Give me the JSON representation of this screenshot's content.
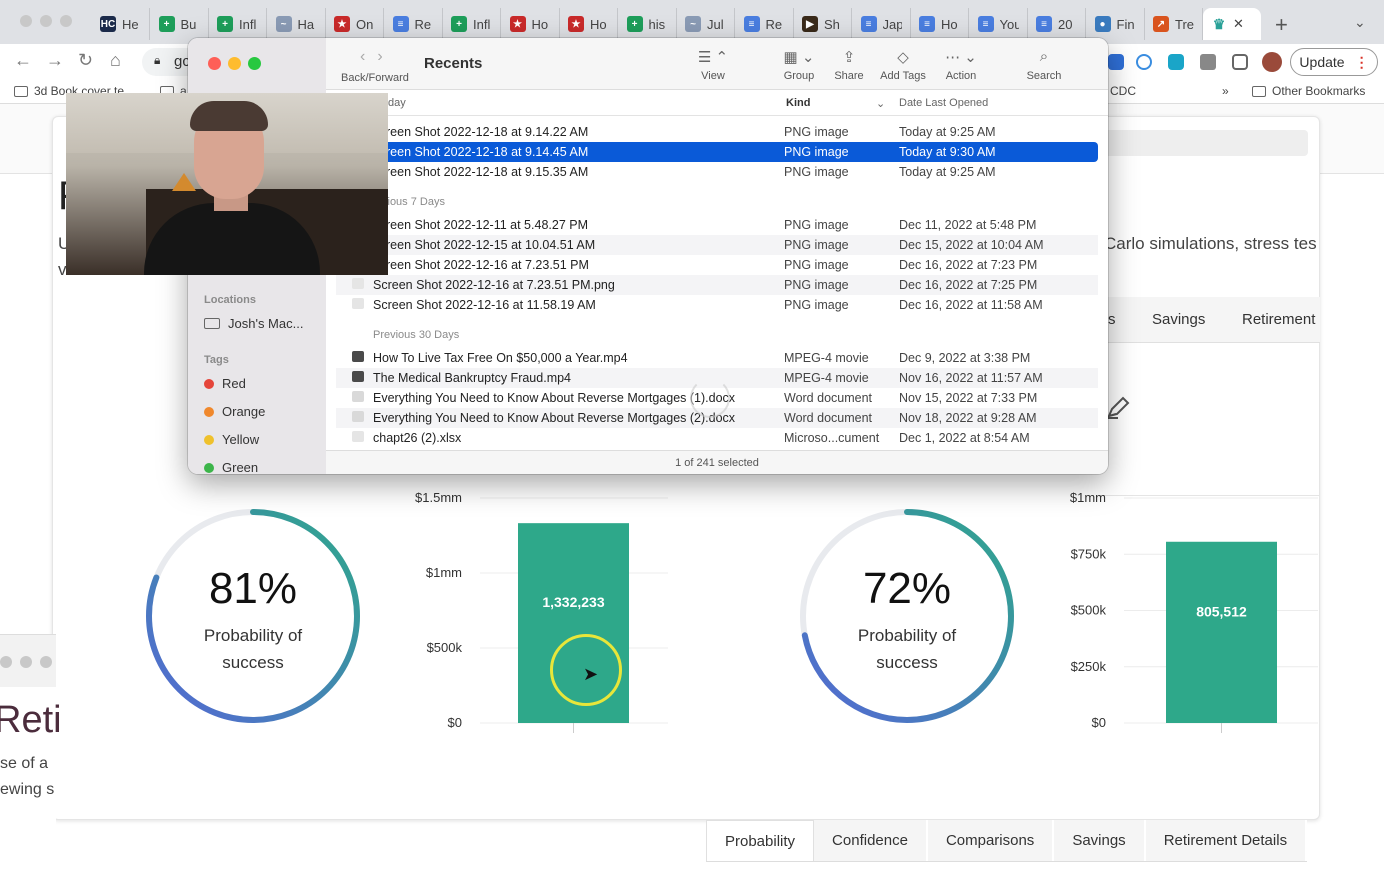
{
  "browser": {
    "tabs": [
      {
        "label": "He",
        "favicon": "hc-icon",
        "color": "#1b2a4a",
        "glyph": "HC"
      },
      {
        "label": "Bu",
        "favicon": "sheets-icon",
        "color": "#1e9e5a",
        "glyph": "+"
      },
      {
        "label": "Infl",
        "favicon": "sheets-icon",
        "color": "#1e9e5a",
        "glyph": "+"
      },
      {
        "label": "Ha",
        "favicon": "image-icon",
        "color": "#8a9bb5",
        "glyph": "~"
      },
      {
        "label": "On",
        "favicon": "star-icon",
        "color": "#c92a2a",
        "glyph": "★"
      },
      {
        "label": "Re",
        "favicon": "docs-icon",
        "color": "#4a7ee0",
        "glyph": "≡"
      },
      {
        "label": "Infl",
        "favicon": "sheets-icon",
        "color": "#1e9e5a",
        "glyph": "+"
      },
      {
        "label": "Ho",
        "favicon": "star-icon",
        "color": "#c92a2a",
        "glyph": "★"
      },
      {
        "label": "Ho",
        "favicon": "star-icon",
        "color": "#c92a2a",
        "glyph": "★"
      },
      {
        "label": "his",
        "favicon": "sheets-icon",
        "color": "#1e9e5a",
        "glyph": "+"
      },
      {
        "label": "Jul",
        "favicon": "image-icon",
        "color": "#8a9bb5",
        "glyph": "~"
      },
      {
        "label": "Re",
        "favicon": "docs-icon",
        "color": "#4a7ee0",
        "glyph": "≡"
      },
      {
        "label": "Sh",
        "favicon": "video-icon",
        "color": "#3a2a1a",
        "glyph": "▶"
      },
      {
        "label": "Jap",
        "favicon": "docs-icon",
        "color": "#4a7ee0",
        "glyph": "≡"
      },
      {
        "label": "Ho",
        "favicon": "docs-icon",
        "color": "#4a7ee0",
        "glyph": "≡"
      },
      {
        "label": "You",
        "favicon": "docs-icon",
        "color": "#4a7ee0",
        "glyph": "≡"
      },
      {
        "label": "20",
        "favicon": "docs-icon",
        "color": "#4a7ee0",
        "glyph": "≡"
      },
      {
        "label": "Fin",
        "favicon": "drop-icon",
        "color": "#3a7bbf",
        "glyph": "●"
      },
      {
        "label": "Tre",
        "favicon": "chart-icon",
        "color": "#d9541e",
        "glyph": "↗"
      }
    ],
    "active_tab_favicon_color": "#2aa198",
    "address": "gc",
    "update_label": "Update",
    "bookmarks": {
      "first": "3d Book cover te",
      "second": "a",
      "cdc": "CDC",
      "more": "»",
      "other": "Other Bookmarks"
    }
  },
  "finder": {
    "title": "Recents",
    "back_forward_label": "Back/Forward",
    "tools": [
      {
        "label": "View",
        "icon": "list-view-icon",
        "glyph": "☰ ⌃"
      },
      {
        "label": "Group",
        "icon": "group-icon",
        "glyph": "▦ ⌄"
      },
      {
        "label": "Share",
        "icon": "share-icon",
        "glyph": "⇪"
      },
      {
        "label": "Add Tags",
        "icon": "tag-icon",
        "glyph": "◇"
      },
      {
        "label": "Action",
        "icon": "action-icon",
        "glyph": "⋯ ⌄"
      },
      {
        "label": "Search",
        "icon": "search-icon",
        "glyph": "⌕"
      }
    ],
    "columns": {
      "name": "day",
      "kind": "Kind",
      "date": "Date Last Opened"
    },
    "sidebar": {
      "locations_label": "Locations",
      "location_item": "Josh's Mac...",
      "tags_label": "Tags",
      "tags": [
        {
          "name": "Red",
          "color": "#e5453a"
        },
        {
          "name": "Orange",
          "color": "#f0882c"
        },
        {
          "name": "Yellow",
          "color": "#efc12c"
        },
        {
          "name": "Green",
          "color": "#3cb54a"
        }
      ]
    },
    "groups": {
      "previous7": "vious 7 Days",
      "previous30": "Previous 30 Days"
    },
    "rows_today": [
      {
        "name": "reen Shot 2022-12-18 at 9.14.22 AM",
        "kind": "PNG image",
        "date": "Today at 9:25 AM"
      },
      {
        "name": "reen Shot 2022-12-18 at 9.14.45 AM",
        "kind": "PNG image",
        "date": "Today at 9:30 AM"
      },
      {
        "name": "reen Shot 2022-12-18 at 9.15.35 AM",
        "kind": "PNG image",
        "date": "Today at 9:25 AM"
      }
    ],
    "rows_7": [
      {
        "name": "reen Shot 2022-12-11 at 5.48.27 PM",
        "kind": "PNG image",
        "date": "Dec 11, 2022 at 5:48 PM"
      },
      {
        "name": "reen Shot 2022-12-15 at 10.04.51 AM",
        "kind": "PNG image",
        "date": "Dec 15, 2022 at 10:04 AM"
      },
      {
        "name": "reen Shot 2022-12-16 at 7.23.51 PM",
        "kind": "PNG image",
        "date": "Dec 16, 2022 at 7:23 PM"
      },
      {
        "name": "Screen Shot 2022-12-16 at 7.23.51 PM.png",
        "kind": "PNG image",
        "date": "Dec 16, 2022 at 7:25 PM"
      },
      {
        "name": "Screen Shot 2022-12-16 at 11.58.19 AM",
        "kind": "PNG image",
        "date": "Dec 16, 2022 at 11:58 AM"
      }
    ],
    "rows_30": [
      {
        "name": "How To Live Tax Free On $50,000 a Year.mp4",
        "kind": "MPEG-4 movie",
        "date": "Dec 9, 2022 at 3:38 PM",
        "icon": "movie-icon"
      },
      {
        "name": "The Medical Bankruptcy Fraud.mp4",
        "kind": "MPEG-4 movie",
        "date": "Nov 16, 2022 at 11:57 AM",
        "icon": "movie-icon"
      },
      {
        "name": "Everything You Need to Know About Reverse Mortgages (1).docx",
        "kind": "Word document",
        "date": "Nov 15, 2022 at 7:33 PM",
        "icon": "doc-icon"
      },
      {
        "name": "Everything You Need to Know About Reverse Mortgages (2).docx",
        "kind": "Word document",
        "date": "Nov 18, 2022 at 9:28 AM",
        "icon": "doc-icon"
      },
      {
        "name": "chapt26 (2).xlsx",
        "kind": "Microso...cument",
        "date": "Dec 1, 2022 at 8:54 AM",
        "icon": "sheet-icon"
      }
    ],
    "status": "1 of 241 selected"
  },
  "page": {
    "title_partial": "F",
    "subtitle_partial": "U",
    "subtitle_line2_partial": "v",
    "subtitle_right": "Carlo simulations, stress tes",
    "tabs_right": [
      "s",
      "Savings",
      "Retirement"
    ],
    "left_panel": {
      "probability": "81%",
      "prob_label": "Probability of success",
      "chart": {
        "ticks": [
          "$1.5mm",
          "$1mm",
          "$500k",
          "$0"
        ],
        "value_label": "1,332,233"
      }
    },
    "right_panel": {
      "probability": "72%",
      "prob_label": "Probability of success",
      "chart": {
        "ticks": [
          "$1mm",
          "$750k",
          "$500k",
          "$250k",
          "$0"
        ],
        "value_label": "805,512"
      }
    },
    "bottom_tabs": [
      "Probability",
      "Confidence",
      "Comparisons",
      "Savings",
      "Retirement Details"
    ],
    "underlying_window": {
      "title_partial": "Reti",
      "line1": "se of a",
      "line2": "ewing s"
    },
    "colors": {
      "accent_bar": "#2ea88a",
      "gauge_start": "#5567d6",
      "gauge_end": "#2ea88a",
      "cursor_ring": "#e8e63a"
    }
  },
  "chart_data": [
    {
      "type": "bar",
      "categories": [
        ""
      ],
      "values": [
        1332233
      ],
      "ylim": [
        0,
        1500000
      ],
      "yticks": [
        "$0",
        "$500k",
        "$1mm",
        "$1.5mm"
      ],
      "title": "",
      "xlabel": "",
      "ylabel": ""
    },
    {
      "type": "bar",
      "categories": [
        ""
      ],
      "values": [
        805512
      ],
      "ylim": [
        0,
        1000000
      ],
      "yticks": [
        "$0",
        "$250k",
        "$500k",
        "$750k",
        "$1mm"
      ],
      "title": "",
      "xlabel": "",
      "ylabel": ""
    }
  ]
}
